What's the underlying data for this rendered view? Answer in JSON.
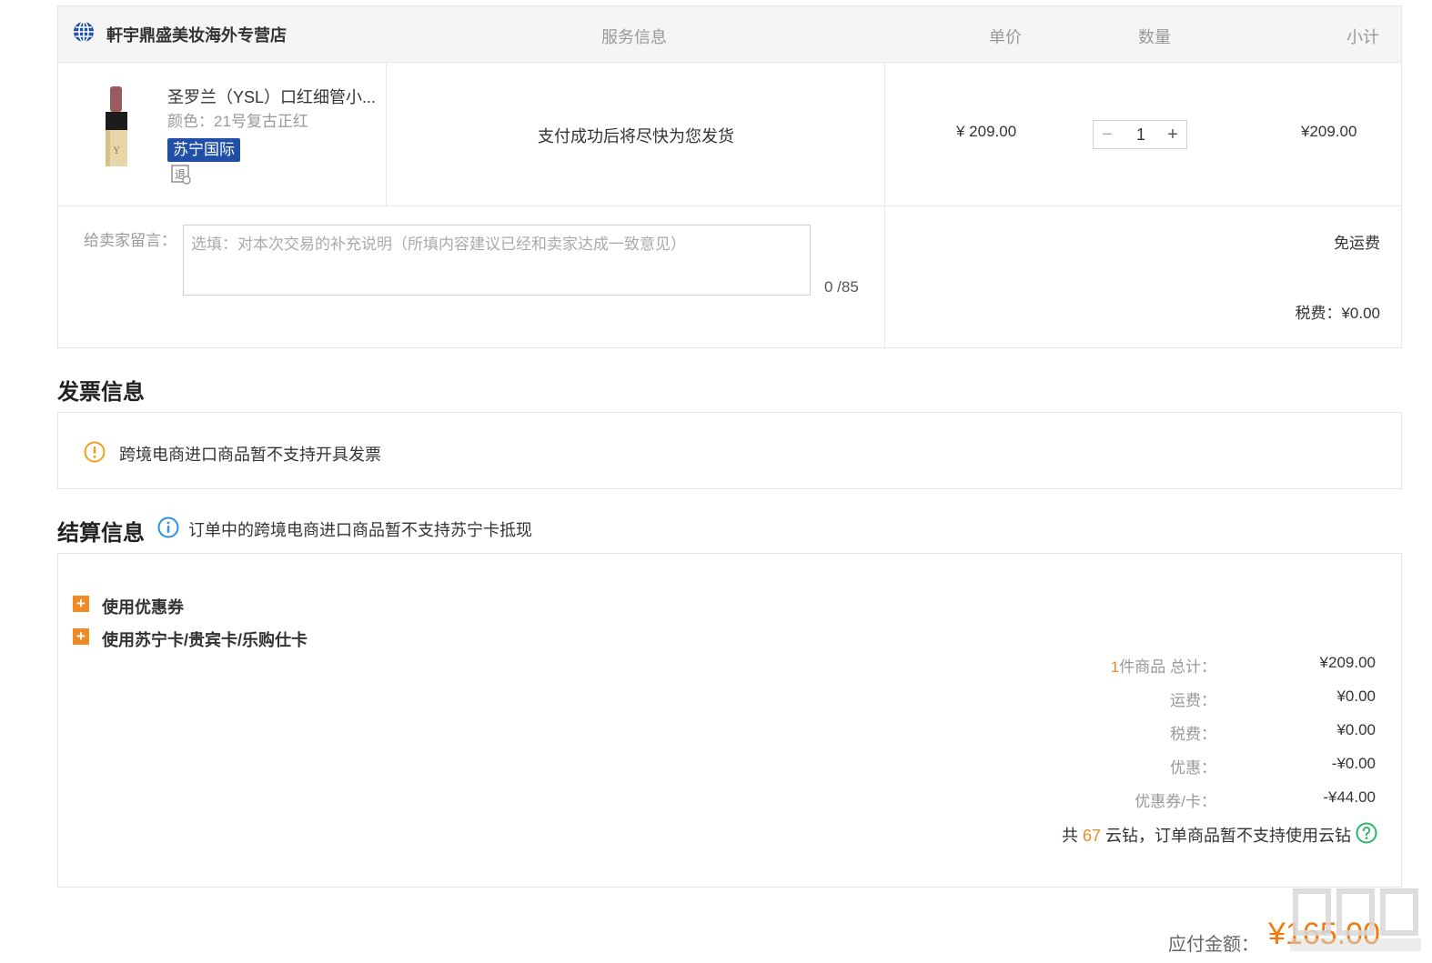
{
  "order": {
    "store_name": "軒宇鼎盛美妆海外专营店",
    "columns": {
      "service": "服务信息",
      "unit_price": "单价",
      "quantity": "数量",
      "subtotal": "小计"
    },
    "item": {
      "title": "圣罗兰（YSL）口红细管小...",
      "color": "颜色：21号复古正红",
      "badge": "苏宁国际",
      "return_icon": "return-icon",
      "service": "支付成功后将尽快为您发货",
      "unit_price": "¥ 209.00",
      "quantity": "1",
      "subtotal": "¥209.00"
    },
    "message": {
      "label": "给卖家留言：",
      "placeholder": "选填：对本次交易的补充说明（所填内容建议已经和卖家达成一致意见）",
      "count": "0 /85"
    },
    "shipping": "免运费",
    "tax": "税费：¥0.00"
  },
  "invoice": {
    "title": "发票信息",
    "note": "跨境电商进口商品暂不支持开具发票"
  },
  "settlement": {
    "title": "结算信息",
    "note": "订单中的跨境电商进口商品暂不支持苏宁卡抵现",
    "options": [
      "使用优惠券",
      "使用苏宁卡/贵宾卡/乐购仕卡"
    ],
    "summary": {
      "items_count": "1",
      "items_label": "件商品 总计：",
      "items_value": "¥209.00",
      "shipping_label": "运费：",
      "shipping_value": "¥0.00",
      "tax_label": "税费：",
      "tax_value": "¥0.00",
      "discount_label": "优惠：",
      "discount_value": "-¥0.00",
      "coupon_label": "优惠券/卡：",
      "coupon_value": "-¥44.00"
    },
    "cloud": {
      "prefix": "共",
      "count": "67",
      "suffix": "云钻，订单商品暂不支持使用云钻"
    }
  },
  "payable": {
    "label": "应付金额：",
    "amount": "¥165.00"
  },
  "colors": {
    "accent": "#f08a24",
    "badge": "#1f4fa6",
    "info": "#2d8fe0",
    "help": "#2db46b"
  }
}
